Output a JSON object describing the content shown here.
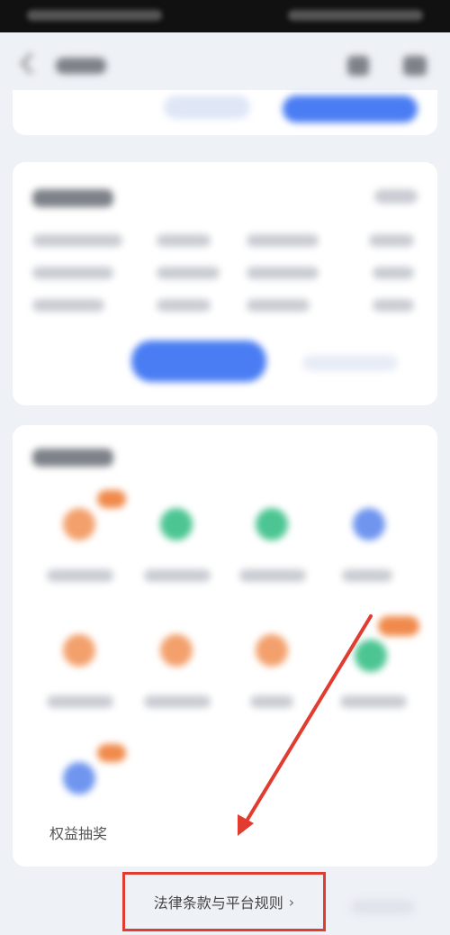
{
  "lottery": {
    "label": "权益抽奖"
  },
  "footer": {
    "link_label": "法律条款与平台规则",
    "chevron": "›"
  },
  "annotation": {
    "arrow_color": "#e23b30",
    "box_color": "#e23b30"
  },
  "colors": {
    "accent_blue": "#4a7df3",
    "orange": "#f08a4b",
    "green": "#3fbf8a"
  }
}
